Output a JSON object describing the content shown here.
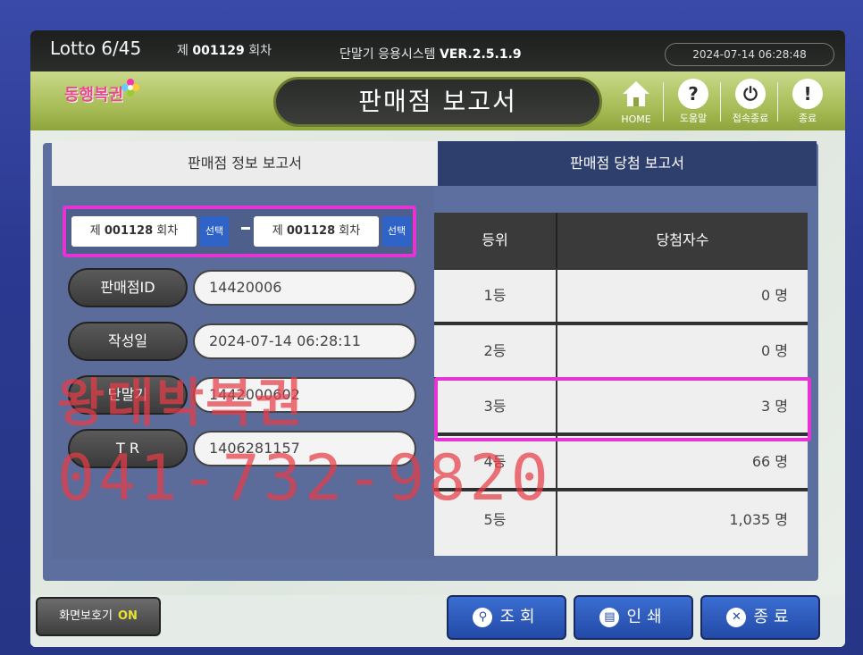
{
  "statusbar": {
    "product": "Lotto 6/45",
    "round_prefix": "제",
    "round_number": "001129",
    "round_suffix": "회차",
    "system_label": "단말기 응용시스템",
    "version": "VER.2.5.1.9",
    "datetime": "2024-07-14 06:28:48"
  },
  "header": {
    "logo": "동행복권",
    "title": "판매점 보고서",
    "buttons": [
      {
        "label": "HOME",
        "icon": "home-icon"
      },
      {
        "label": "도움말",
        "icon": "help-icon"
      },
      {
        "label": "접속종료",
        "icon": "power-icon"
      },
      {
        "label": "종료",
        "icon": "exit-icon"
      }
    ]
  },
  "tabs": {
    "left": "판매점 정보 보고서",
    "right": "판매점 당첨 보고서"
  },
  "range": {
    "from_prefix": "제",
    "from_number": "001128",
    "from_suffix": "회차",
    "to_prefix": "제",
    "to_number": "001128",
    "to_suffix": "회차",
    "select_label": "선택"
  },
  "fields": [
    {
      "label": "판매점ID",
      "value": "14420006"
    },
    {
      "label": "작성일",
      "value": "2024-07-14 06:28:11"
    },
    {
      "label": "단말기",
      "value": "1442000602"
    },
    {
      "label": "T R",
      "value": "1406281157"
    }
  ],
  "table": {
    "headers": [
      "등위",
      "당첨자수"
    ],
    "rows": [
      {
        "rank": "1등",
        "count": "0 명"
      },
      {
        "rank": "2등",
        "count": "0 명"
      },
      {
        "rank": "3등",
        "count": "3 명"
      },
      {
        "rank": "4등",
        "count": "66 명"
      },
      {
        "rank": "5등",
        "count": "1,035 명"
      }
    ]
  },
  "watermark": {
    "line1": "왕대박복권",
    "line2": "041-732-9820"
  },
  "footer": {
    "screensaver_label": "화면보호기",
    "screensaver_state": "ON",
    "search_label": "조회",
    "print_label": "인쇄",
    "exit_label": "종료"
  },
  "colors": {
    "highlight": "#e633d4",
    "button_blue": "#234aa6",
    "header_green": "#a9bd58"
  }
}
